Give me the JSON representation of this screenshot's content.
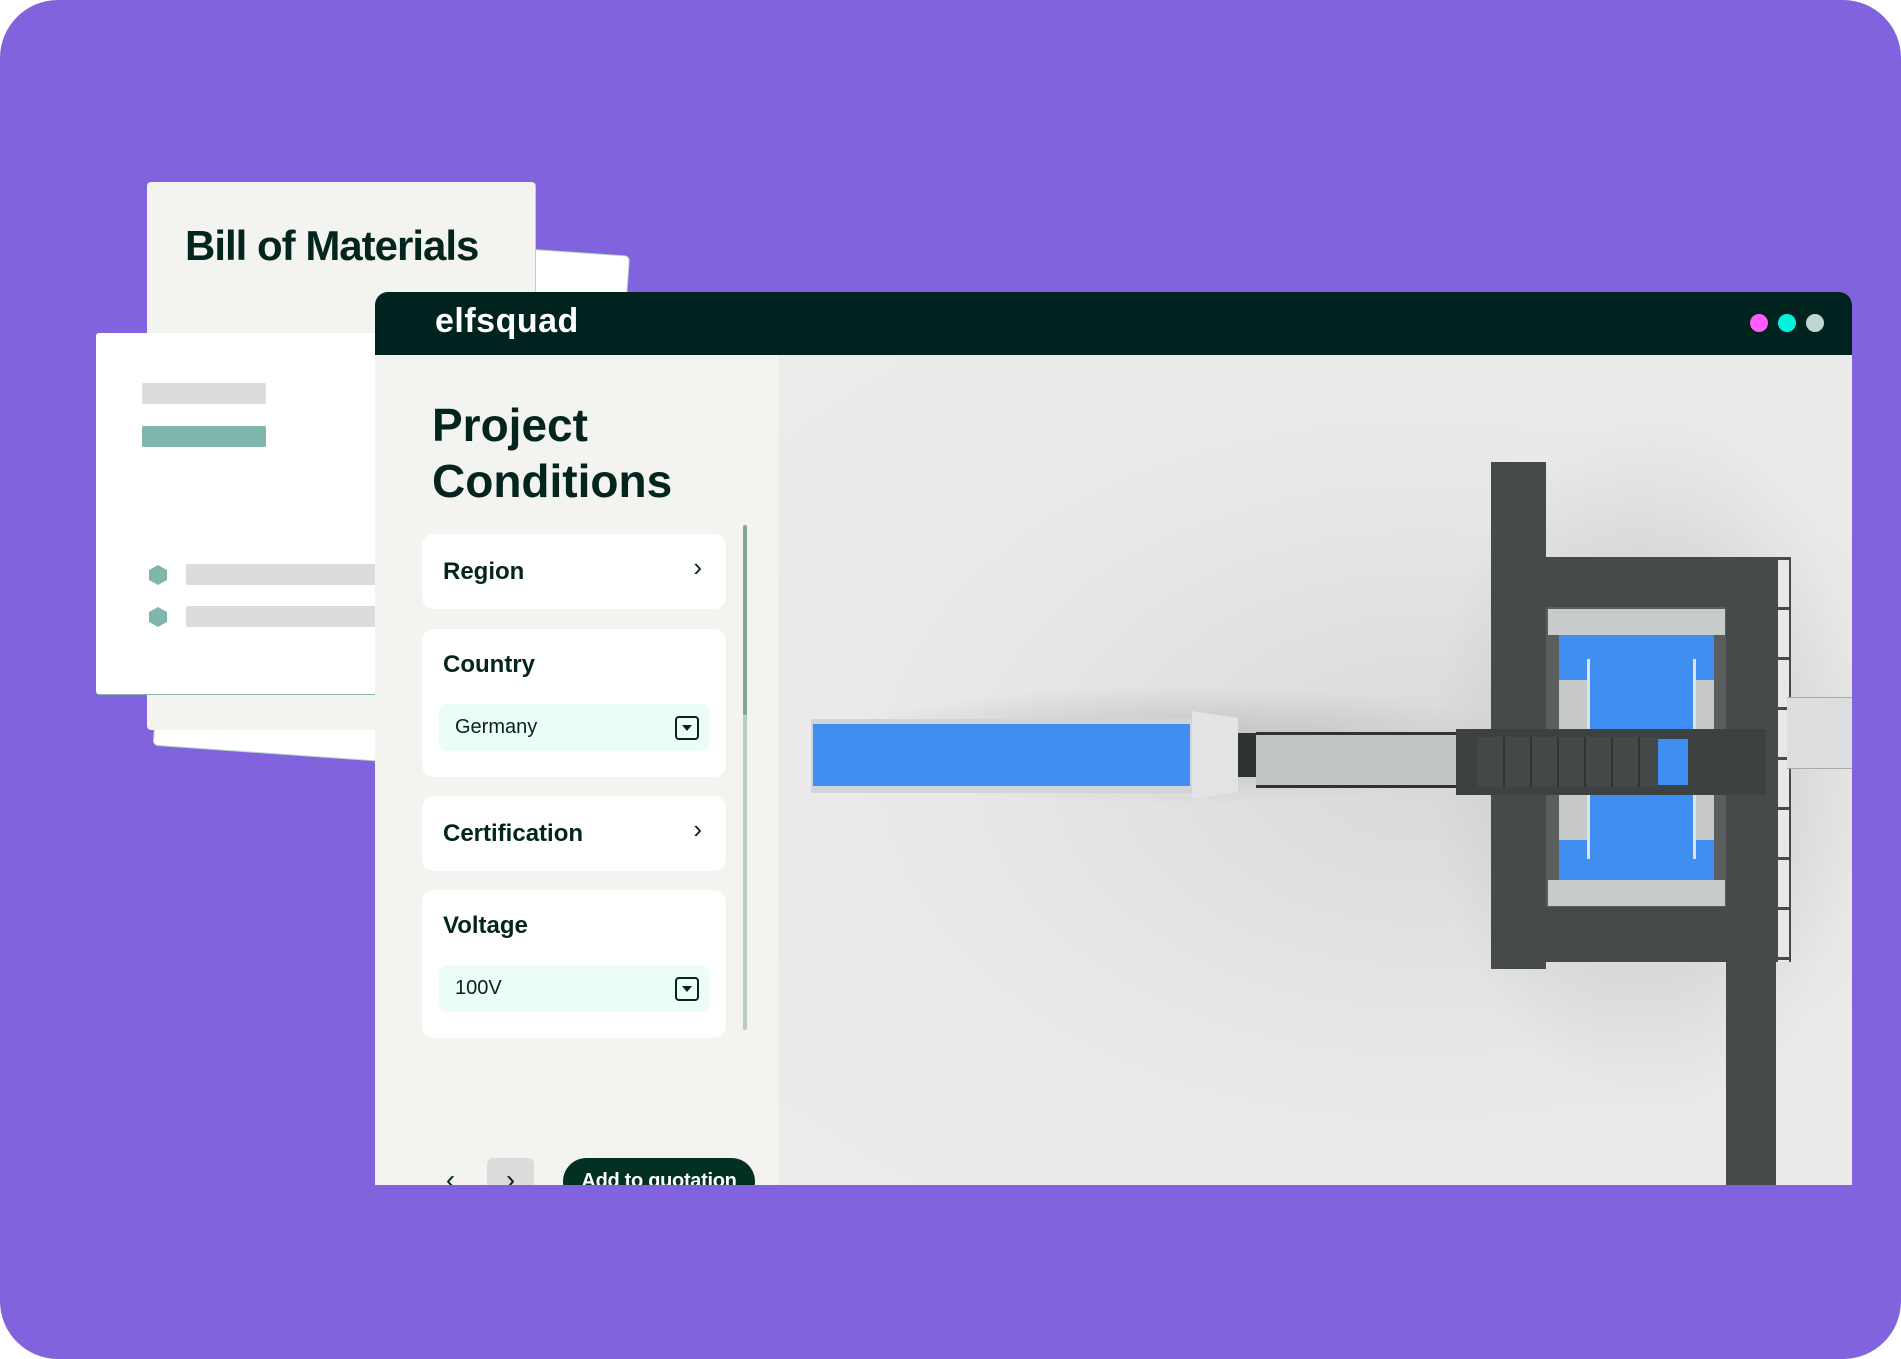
{
  "background_docs": {
    "bom_title": "Bill of Materials"
  },
  "window": {
    "logo": "elfsquad",
    "window_dots": [
      {
        "name": "magenta-dot",
        "color": "#fe5cfc"
      },
      {
        "name": "cyan-dot",
        "color": "#02f2e0"
      },
      {
        "name": "gray-dot",
        "color": "#bcd7d0"
      }
    ]
  },
  "sidebar": {
    "title": "Project Conditions",
    "steps": [
      {
        "label": "Region",
        "type": "link"
      },
      {
        "label": "Country",
        "type": "select",
        "value": "Germany"
      },
      {
        "label": "Certification",
        "type": "link"
      },
      {
        "label": "Voltage",
        "type": "select",
        "value": "100V"
      }
    ],
    "prev_icon": "‹",
    "next_icon": "›",
    "chevron": "›",
    "add_to_quotation_label": "Add to quotation"
  },
  "viewer": {
    "accent_blue": "#3f8ff2",
    "frame_dark": "#474a4a",
    "panel_gray": "#c8cbcc"
  }
}
